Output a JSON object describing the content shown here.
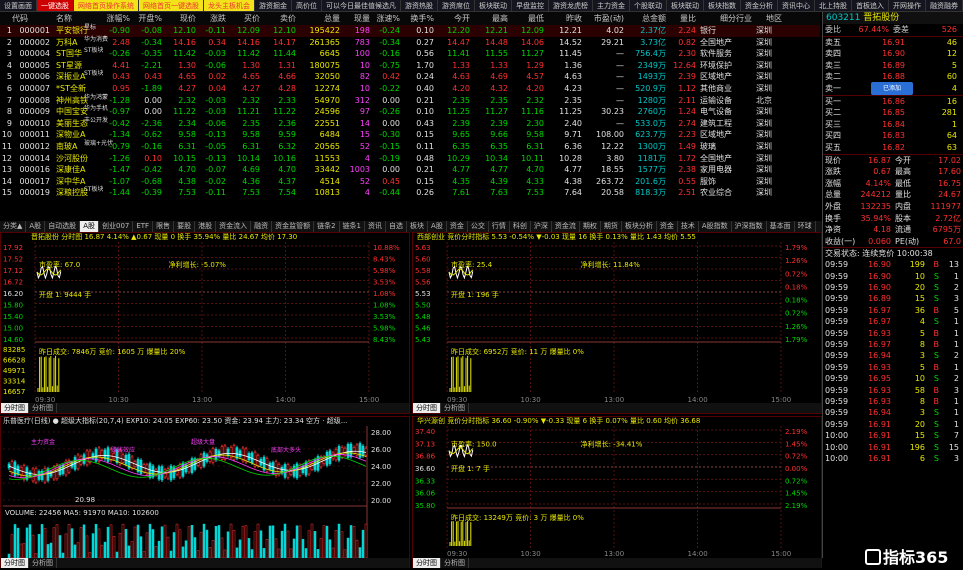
{
  "colors": {
    "up": "#ff3030",
    "down": "#00d800",
    "flat": "#e0e0e0",
    "accent": "#e8e800",
    "border": "#550000"
  },
  "top_tabs": [
    "设置画面",
    "一键选股",
    "网络首页操作系统",
    "网络首页一键选股",
    "龙头主板机会",
    "游资掘金",
    "高价位",
    "可以今日最佳值候选凡",
    "游资热股",
    "游资席位",
    "板块联动",
    "早盘监控",
    "游资龙虎榜",
    "主力资金",
    "个股联动",
    "板块联动",
    "板块指数",
    "资金分析",
    "资讯中心",
    "北上持股",
    "首板追入",
    "开网操作",
    "融资融券",
    "F5切换",
    "关闭"
  ],
  "quote": {
    "headers": [
      "代码",
      "名称",
      "涨幅%",
      "开盘%",
      "现价",
      "涨跌",
      "买价",
      "卖价",
      "总量",
      "现量",
      "涨速%",
      "换手%",
      "今开",
      "最高",
      "最低",
      "昨收",
      "市盈(动)",
      "总金额",
      "量比",
      "细分行业",
      "地区"
    ],
    "rows": [
      [
        "000001",
        "平安银行",
        "-0.90",
        "-0.08",
        "12.10",
        "-0.11",
        "12.09",
        "12.10",
        "195422",
        "198",
        "-0.24",
        "0.10",
        "12.20",
        "12.21",
        "12.09",
        "12.21",
        "4.02",
        "2.37亿",
        "2.24",
        "银行",
        "深圳"
      ],
      [
        "000002",
        "万科A",
        "2.48",
        "-0.34",
        "14.16",
        "0.34",
        "14.16",
        "14.17",
        "261365",
        "783",
        "-0.34",
        "0.27",
        "14.47",
        "14.48",
        "14.06",
        "14.52",
        "29.21",
        "3.73亿",
        "0.82",
        "全国地产",
        "深圳"
      ],
      [
        "000004",
        "ST国华",
        "-0.26",
        "-0.35",
        "11.42",
        "-0.03",
        "11.42",
        "11.44",
        "6645",
        "100",
        "-0.16",
        "0.56",
        "11.41",
        "11.55",
        "11.27",
        "11.45",
        "—",
        "756.4万",
        "2.30",
        "软件服务",
        "深圳"
      ],
      [
        "000005",
        "ST星源",
        "4.41",
        "-2.21",
        "1.30",
        "-0.06",
        "1.30",
        "1.31",
        "180075",
        "10",
        "-0.75",
        "1.70",
        "1.33",
        "1.33",
        "1.29",
        "1.36",
        "—",
        "2349万",
        "12.64",
        "环境保护",
        "深圳"
      ],
      [
        "000006",
        "深振业A",
        "0.43",
        "0.43",
        "4.65",
        "0.02",
        "4.65",
        "4.66",
        "32050",
        "82",
        "0.42",
        "0.24",
        "4.63",
        "4.69",
        "4.57",
        "4.63",
        "—",
        "1493万",
        "2.39",
        "区域地产",
        "深圳"
      ],
      [
        "000007",
        "*ST全新",
        "0.95",
        "-1.89",
        "4.27",
        "0.04",
        "4.27",
        "4.28",
        "12274",
        "10",
        "-0.22",
        "0.40",
        "4.20",
        "4.32",
        "4.20",
        "4.23",
        "—",
        "520.9万",
        "1.12",
        "其他商业",
        "深圳"
      ],
      [
        "000008",
        "神州高铁",
        "-1.28",
        "0.00",
        "2.32",
        "-0.03",
        "2.32",
        "2.33",
        "54970",
        "312",
        "0.00",
        "0.21",
        "2.35",
        "2.35",
        "2.32",
        "2.35",
        "—",
        "1280万",
        "2.11",
        "运输设备",
        "北京"
      ],
      [
        "000009",
        "中国宝安",
        "-0.97",
        "0.00",
        "11.22",
        "-0.03",
        "11.21",
        "11.22",
        "24596",
        "97",
        "-0.26",
        "0.10",
        "11.25",
        "11.27",
        "11.16",
        "11.25",
        "30.23",
        "2760万",
        "1.24",
        "电气设备",
        "深圳"
      ],
      [
        "000010",
        "美丽生态",
        "-0.42",
        "-2.36",
        "2.34",
        "-0.06",
        "2.35",
        "2.36",
        "22551",
        "14",
        "0.00",
        "0.43",
        "2.39",
        "2.39",
        "2.30",
        "2.40",
        "—",
        "533.0万",
        "2.74",
        "建筑工程",
        "深圳"
      ],
      [
        "000011",
        "深物业A",
        "-1.34",
        "-0.62",
        "9.58",
        "-0.13",
        "9.58",
        "9.59",
        "6484",
        "15",
        "-0.30",
        "0.15",
        "9.65",
        "9.66",
        "9.58",
        "9.71",
        "108.00",
        "623.7万",
        "2.23",
        "区域地产",
        "深圳"
      ],
      [
        "000012",
        "南玻A",
        "-0.79",
        "-0.16",
        "6.31",
        "-0.05",
        "6.31",
        "6.32",
        "20565",
        "52",
        "-0.15",
        "0.11",
        "6.35",
        "6.35",
        "6.31",
        "6.36",
        "12.22",
        "1300万",
        "1.49",
        "玻璃",
        "深圳"
      ],
      [
        "000014",
        "沙河股份",
        "-1.26",
        "0.10",
        "10.15",
        "-0.13",
        "10.14",
        "10.16",
        "11553",
        "4",
        "-0.19",
        "0.48",
        "10.29",
        "10.34",
        "10.11",
        "10.28",
        "3.80",
        "1181万",
        "1.72",
        "全国地产",
        "深圳"
      ],
      [
        "000016",
        "深康佳A",
        "-1.47",
        "-0.42",
        "4.70",
        "-0.07",
        "4.69",
        "4.70",
        "33442",
        "1003",
        "0.00",
        "0.21",
        "4.77",
        "4.77",
        "4.70",
        "4.77",
        "18.55",
        "1577万",
        "2.38",
        "家用电器",
        "深圳"
      ],
      [
        "000017",
        "深中华A",
        "-1.07",
        "-0.68",
        "4.38",
        "-0.02",
        "4.36",
        "4.37",
        "4514",
        "52",
        "0.45",
        "0.15",
        "4.35",
        "4.39",
        "4.33",
        "4.38",
        "263.72",
        "201.6万",
        "0.55",
        "服饰",
        "深圳"
      ],
      [
        "000019",
        "深粮控股",
        "-1.44",
        "-0.39",
        "7.53",
        "-0.11",
        "7.53",
        "7.54",
        "10813",
        "4",
        "-0.44",
        "0.26",
        "7.61",
        "7.63",
        "7.53",
        "7.64",
        "20.58",
        "818.3万",
        "2.51",
        "农业综合",
        "深圳"
      ]
    ],
    "row_nums": [
      "1",
      "2",
      "3",
      "4",
      "5",
      "6",
      "7",
      "8",
      "9",
      "10",
      "11",
      "12",
      "13",
      "14",
      "15"
    ],
    "tags": {
      "1": "星标",
      "2": "华为消费",
      "3": "ST板块",
      "5": "ST板块",
      "7": "华为鸿蒙",
      "8": "华为手机",
      "9": "丰公开发",
      "11": "玻璃+光伏",
      "15": "ST板块"
    }
  },
  "mid_tabs": [
    "分类▲",
    "A股",
    "自动选股",
    "A股",
    "创业007",
    "ETF",
    "限售",
    "要股",
    "港股",
    "资金流入",
    "融资",
    "资金监管额",
    "链条2",
    "链条1",
    "资讯",
    "自选",
    "板块",
    "A股",
    "资金",
    "公交",
    "行情",
    "科创",
    "沪深",
    "资金流",
    "期权",
    "期货",
    "板块分析",
    "资金",
    "技术",
    "A股指数",
    "沪深指数",
    "基本面",
    "环球"
  ],
  "mid_tabs_on": 3,
  "charts": {
    "c1": {
      "title": "晋拓股份  分时图 16.87 4.14% ▲0.67 现量 0 换手 35.94% 量比 24.67 均价 17.30",
      "left_ticks": [
        "17.92",
        "17.52",
        "17.12",
        "16.72",
        "16.20",
        "15.80",
        "15.40",
        "15.00",
        "14.60",
        "83285",
        "66628",
        "49971",
        "33314",
        "16657"
      ],
      "right_ticks": [
        "10.88%",
        "8.43%",
        "5.98%",
        "3.53%",
        "1.08%",
        "1.08%",
        "3.53%",
        "5.98%",
        "8.43%"
      ],
      "time": [
        "09:30",
        "10:30",
        "13:00",
        "14:00",
        "15:00"
      ],
      "pe": "市盈率: 67.0",
      "net": "净利增长: -5.07%",
      "vol1": "开盘 1: 9444 手",
      "yesterday": "昨日成交: 7846万  竞价: 1605 万  爆量比 20%",
      "bottom_tabs": [
        "分时图",
        "分析图"
      ]
    },
    "c2": {
      "title": "西部创业  竞价分时指标 5.53 -0.54% ▼-0.03 现量 16 换手 0.13% 量比 1.43 均价 5.55",
      "left_ticks": [
        "5.63",
        "5.60",
        "5.58",
        "5.56",
        "5.53",
        "5.50",
        "5.48",
        "5.46",
        "5.43"
      ],
      "right_ticks": [
        "1.79%",
        "1.26%",
        "0.72%",
        "0.18%",
        "0.18%",
        "0.72%",
        "1.26%",
        "1.79%"
      ],
      "time": [
        "09:30",
        "10:30",
        "13:00",
        "14:00",
        "15:00"
      ],
      "pe": "市盈率: 25.4",
      "net": "净利增长: 11.84%",
      "vol1": "开盘 1: 196 手",
      "yesterday": "昨日成交: 6952万  竞价: 11 万  爆量比 0%",
      "bottom_tabs": [
        "分时图",
        "分析图"
      ]
    },
    "c3": {
      "title": "乐普医疗(日线) ● 超级大指标(20,7,4)  EXP10: 24.05  EXP60: 23.50  资金: 23.94  主力: 23.34  空方 · 超级...",
      "right_ticks": [
        "28.00",
        "26.00",
        "24.00",
        "22.00",
        "20.00"
      ],
      "vol_title": "VOLUME: 22456  MA5: 91970  MA10: 102600",
      "low_label": "20.98",
      "bottom_tabs": [
        "分时图",
        "分析图"
      ],
      "labels": [
        "主力资金",
        "赚钱效应",
        "超级大盘",
        "底部大多头"
      ]
    },
    "c4": {
      "title": "华兴源创  竞价分时指标 36.60 -0.90% ▼-0.33 现量 6 换手 0.07% 量比 0.60 均价 36.68",
      "left_ticks": [
        "37.40",
        "37.13",
        "36.86",
        "36.60",
        "36.33",
        "36.06",
        "35.80"
      ],
      "right_ticks": [
        "2.19%",
        "1.45%",
        "0.72%",
        "0.00%",
        "0.72%",
        "1.45%",
        "2.19%"
      ],
      "time": [
        "09:30",
        "10:30",
        "13:00",
        "14:00",
        "15:00"
      ],
      "pe": "市盈率: 150.0",
      "net": "净利增长: -34.41%",
      "vol1": "开盘 1: 7 手",
      "yesterday": "昨日成交: 13249万  竞价: 3 万  爆量比 0%",
      "bottom_tabs": [
        "分时图",
        "分析图"
      ]
    }
  },
  "right": {
    "code": "603211",
    "name": "晋拓股份",
    "wei": {
      "label1": "委比",
      "v1": "67.44%",
      "label2": "委差",
      "v2": "526"
    },
    "asks": [
      [
        "卖五",
        "16.91",
        "46"
      ],
      [
        "卖四",
        "16.90",
        "12"
      ],
      [
        "卖三",
        "16.89",
        "5"
      ],
      [
        "卖二",
        "16.88",
        "60"
      ],
      [
        "卖一",
        "16.87",
        "4"
      ]
    ],
    "bids": [
      [
        "买一",
        "16.86",
        "16"
      ],
      [
        "买二",
        "16.85",
        "281"
      ],
      [
        "买三",
        "16.84",
        "1"
      ],
      [
        "买四",
        "16.83",
        "64"
      ],
      [
        "买五",
        "16.82",
        "63"
      ]
    ],
    "stats": [
      [
        "现价",
        "16.87",
        "今开",
        "17.02"
      ],
      [
        "涨跌",
        "0.67",
        "最高",
        "17.60"
      ],
      [
        "涨幅",
        "4.14%",
        "最低",
        "16.75"
      ],
      [
        "总量",
        "244212",
        "量比",
        "24.67"
      ],
      [
        "外盘",
        "132235",
        "内盘",
        "111977"
      ],
      [
        "换手",
        "35.94%",
        "股本",
        "2.72亿"
      ],
      [
        "净资",
        "4.18",
        "流通",
        "6795万"
      ],
      [
        "收益(一)",
        "0.060",
        "PE(动)",
        "67.0"
      ]
    ],
    "trade_title": "交易状态: 连续竞价  10:00:38",
    "trades": [
      [
        "09:59",
        "16.90",
        "199",
        "B",
        "13"
      ],
      [
        "09:59",
        "16.90",
        "10",
        "S",
        "1"
      ],
      [
        "09:59",
        "16.90",
        "20",
        "S",
        "2"
      ],
      [
        "09:59",
        "16.89",
        "15",
        "S",
        "3"
      ],
      [
        "09:59",
        "16.97",
        "36",
        "B",
        "5"
      ],
      [
        "09:59",
        "16.97",
        "4",
        "S",
        "1"
      ],
      [
        "09:59",
        "16.93",
        "5",
        "B",
        "1"
      ],
      [
        "09:59",
        "16.97",
        "8",
        "B",
        "1"
      ],
      [
        "09:59",
        "16.94",
        "3",
        "S",
        "2"
      ],
      [
        "09:59",
        "16.93",
        "5",
        "B",
        "1"
      ],
      [
        "09:59",
        "16.95",
        "10",
        "S",
        "2"
      ],
      [
        "09:59",
        "16.93",
        "58",
        "B",
        "3"
      ],
      [
        "09:59",
        "16.93",
        "8",
        "B",
        "1"
      ],
      [
        "09:59",
        "16.94",
        "3",
        "S",
        "1"
      ],
      [
        "09:59",
        "16.91",
        "20",
        "S",
        "1"
      ],
      [
        "10:00",
        "16.91",
        "15",
        "S",
        "7"
      ],
      [
        "10:00",
        "16.91",
        "196",
        "S",
        "15"
      ],
      [
        "10:00",
        "16.91",
        "6",
        "S",
        "3"
      ],
      [
        "10:00",
        "16.91",
        "14",
        "S",
        "1"
      ],
      [
        "10:00",
        "16.91",
        "12",
        "S",
        "2"
      ],
      [
        "10:00",
        "16.90",
        "9",
        "S",
        "2"
      ],
      [
        "10:00",
        "16.89",
        "2",
        "S",
        "1"
      ],
      [
        "10:00",
        "16.88",
        "18",
        "S",
        "1"
      ],
      [
        "10:00",
        "16.88",
        "8",
        "S",
        "1"
      ],
      [
        "10:00",
        "16.87",
        "20",
        "S",
        "1"
      ],
      [
        "10:00",
        "16.87",
        "5",
        "S",
        "1"
      ],
      [
        "10:00",
        "16.87",
        "6",
        "S",
        "1"
      ]
    ],
    "badge": "已添加"
  },
  "watermark": "指标365"
}
